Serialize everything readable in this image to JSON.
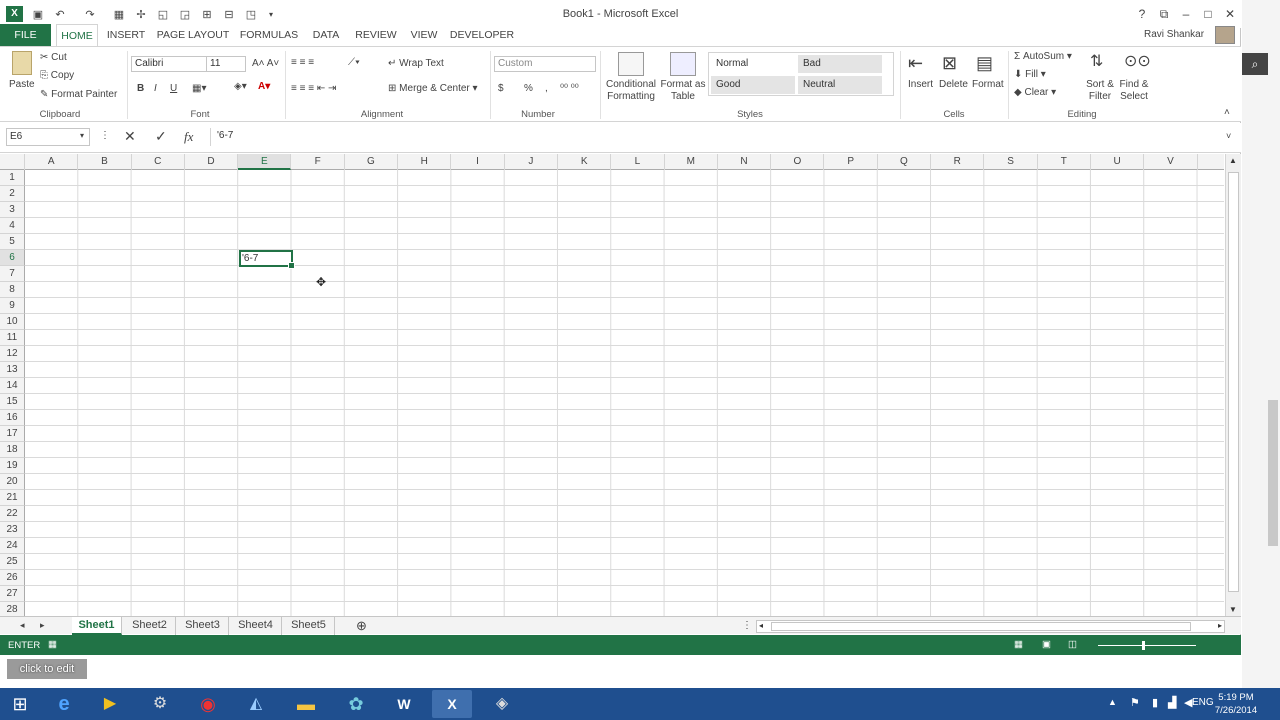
{
  "window": {
    "title": "Book1 - Microsoft Excel",
    "help": "?"
  },
  "ribbon_tabs": [
    "FILE",
    "HOME",
    "INSERT",
    "PAGE LAYOUT",
    "FORMULAS",
    "DATA",
    "REVIEW",
    "VIEW",
    "DEVELOPER"
  ],
  "user": "Ravi Shankar",
  "clipboard": {
    "paste": "Paste",
    "cut": "Cut",
    "copy": "Copy",
    "format_painter": "Format Painter",
    "label": "Clipboard"
  },
  "font": {
    "name": "Calibri",
    "size": "11",
    "bold": "B",
    "italic": "I",
    "underline": "U",
    "label": "Font"
  },
  "alignment": {
    "wrap": "Wrap Text",
    "merge": "Merge & Center",
    "label": "Alignment"
  },
  "number": {
    "format": "Custom",
    "currency": "$",
    "percent": "%",
    "comma": ",",
    "label": "Number"
  },
  "styles": {
    "conditional": "Conditional Formatting",
    "format_table": "Format as Table",
    "normal": "Normal",
    "bad": "Bad",
    "good": "Good",
    "neutral": "Neutral",
    "label": "Styles"
  },
  "cells_group": {
    "insert": "Insert",
    "delete": "Delete",
    "format": "Format",
    "label": "Cells"
  },
  "editing": {
    "autosum": "AutoSum",
    "fill": "Fill",
    "clear": "Clear",
    "sort": "Sort & Filter",
    "find": "Find & Select",
    "label": "Editing"
  },
  "formula_bar": {
    "name_box": "E6",
    "value": "'6-7",
    "cancel": "✕",
    "enter": "✓",
    "fx": "fx"
  },
  "columns": [
    "A",
    "B",
    "C",
    "D",
    "E",
    "F",
    "G",
    "H",
    "I",
    "J",
    "K",
    "L",
    "M",
    "N",
    "O",
    "P",
    "Q",
    "R",
    "S",
    "T",
    "U",
    "V"
  ],
  "rows": [
    "1",
    "2",
    "3",
    "4",
    "5",
    "6",
    "7",
    "8",
    "9",
    "10",
    "11",
    "12",
    "13",
    "14",
    "15",
    "16",
    "17",
    "18",
    "19",
    "20",
    "21",
    "22",
    "23",
    "24",
    "25",
    "26",
    "27",
    "28"
  ],
  "active_cell": {
    "ref": "E6",
    "display": "'6-7"
  },
  "sheets": [
    "Sheet1",
    "Sheet2",
    "Sheet3",
    "Sheet4",
    "Sheet5"
  ],
  "status": {
    "mode": "ENTER"
  },
  "overlay": {
    "edit_hint": "click to edit"
  },
  "taskbar": {
    "language": "ENG",
    "time": "5:19 PM",
    "date": "7/26/2014"
  },
  "colors": {
    "accent": "#217346",
    "taskbar": "#1f4f8f"
  }
}
